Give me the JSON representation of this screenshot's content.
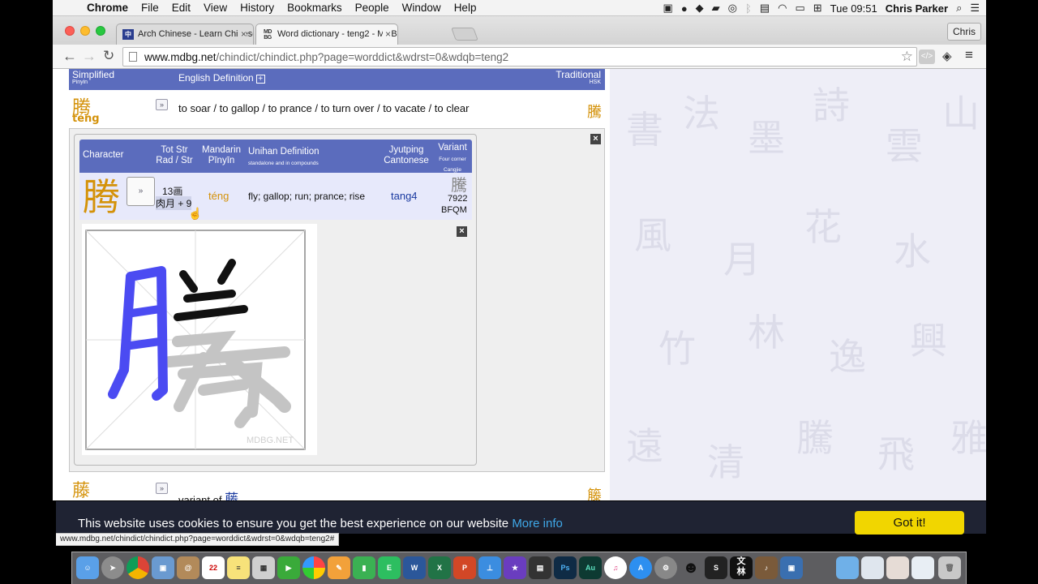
{
  "menubar": {
    "app": "Chrome",
    "items": [
      "File",
      "Edit",
      "View",
      "History",
      "Bookmarks",
      "People",
      "Window",
      "Help"
    ],
    "clock": "Tue 09:51",
    "user": "Chris Parker"
  },
  "browser": {
    "tabs": [
      {
        "title": "Arch Chinese - Learn Chinese",
        "favicon": "arch-chinese-favicon"
      },
      {
        "title": "Word dictionary - teng2 - MDBG",
        "favicon": "mdbg-favicon"
      }
    ],
    "profile": "Chris",
    "url_host": "www.mdbg.net",
    "url_path": "/chindict/chindict.php?page=worddict&wdrst=0&wdqb=teng2",
    "status_url": "www.mdbg.net/chindict/chindict.php?page=worddict&wdrst=0&wdqb=teng2#"
  },
  "table_header": {
    "simplified": "Simplified",
    "pinyin": "Pinyin",
    "english": "English Definition",
    "traditional": "Traditional",
    "hsk": "HSK"
  },
  "entry1": {
    "char": "腾",
    "pinyin": "téng",
    "definition": "to soar / to gallop / to prance / to turn over / to vacate / to clear",
    "traditional": "騰"
  },
  "char_table": {
    "headers": {
      "character": "Character",
      "tot_str": "Tot Str",
      "rad_str": "Rad / Str",
      "mandarin": "Mandarin",
      "pinyin": "Pīnyīn",
      "unihan": "Unihan Definition",
      "unihan_sub": "standalone and in compounds",
      "jyutping": "Jyutping",
      "cantonese": "Cantonese",
      "variant": "Variant",
      "four_corner": "Four corner",
      "cangjie": "Cangjie"
    },
    "row": {
      "char": "腾",
      "strokes": "13画",
      "radical": "肉月 + 9",
      "pinyin": "téng",
      "definition": "fly; gallop; run; prance; rise",
      "jyutping": "tang4",
      "variant": "騰",
      "four_corner": "7922",
      "cangjie": "BFQM"
    }
  },
  "stroke_image": {
    "char": "腾",
    "watermark": "MDBG.NET"
  },
  "entry2": {
    "char": "藤",
    "definition_prefix": "variant of",
    "variant_link": "藤",
    "traditional": "籐"
  },
  "cookie": {
    "message": "This website uses cookies to ensure you get the best experience on our website",
    "link": "More info",
    "button": "Got it!"
  },
  "dock_apps": [
    "Finder",
    "Launchpad",
    "Chrome",
    "Preview",
    "Contacts",
    "Calendar",
    "Notes",
    "Photos",
    "Reminders",
    "FaceTime",
    "Photos",
    "Pages",
    "Numbers",
    "Evernote",
    "Word",
    "Excel",
    "PowerPoint",
    "Keynote",
    "iMovie",
    "Final Cut",
    "Photoshop",
    "Audition",
    "iTunes",
    "App Store",
    "Sys Prefs",
    "QQ",
    "Sketch",
    "文林",
    "Guitar",
    "Photo Booth",
    "Downloads",
    "Folder",
    "Folder",
    "Folder",
    "Trash"
  ],
  "colors": {
    "header_blue": "#5b6cbd",
    "hanzi_orange": "#d4920a",
    "cookie_bg": "#1f2333",
    "cookie_button": "#f1d600",
    "link_blue": "#3fa8e8"
  }
}
